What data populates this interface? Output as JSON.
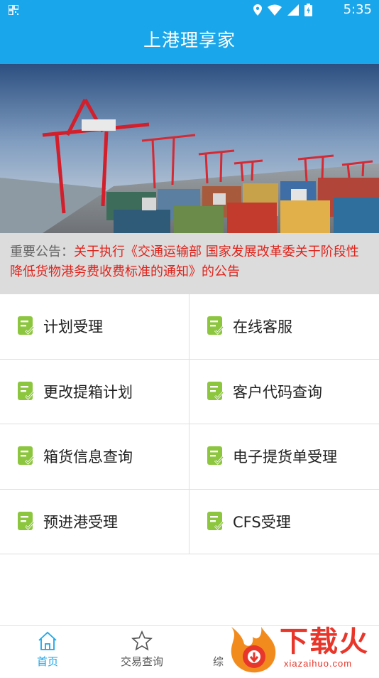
{
  "status_bar": {
    "time": "5:35"
  },
  "app": {
    "title": "上港理享家"
  },
  "notice": {
    "label": "重要公告：",
    "text": "关于执行《交通运输部 国家发展改革委关于阶段性降低货物港务费收费标准的通知》的公告"
  },
  "menu": {
    "items": [
      {
        "label": "计划受理"
      },
      {
        "label": "在线客服"
      },
      {
        "label": "更改提箱计划"
      },
      {
        "label": "客户代码查询"
      },
      {
        "label": "箱货信息查询"
      },
      {
        "label": "电子提货单受理"
      },
      {
        "label": "预进港受理"
      },
      {
        "label": "CFS受理"
      }
    ]
  },
  "tabs": [
    {
      "label": "首页",
      "icon": "home-icon",
      "active": true
    },
    {
      "label": "交易查询",
      "icon": "star-icon",
      "active": false
    },
    {
      "label": "综",
      "icon": "other-icon",
      "active": false
    }
  ],
  "watermark": {
    "text": "下载火",
    "url": "xiazaihuo.com"
  },
  "colors": {
    "primary": "#1aa6ea",
    "notice_red": "#e0241c",
    "menu_icon_green": "#8cc63f"
  }
}
